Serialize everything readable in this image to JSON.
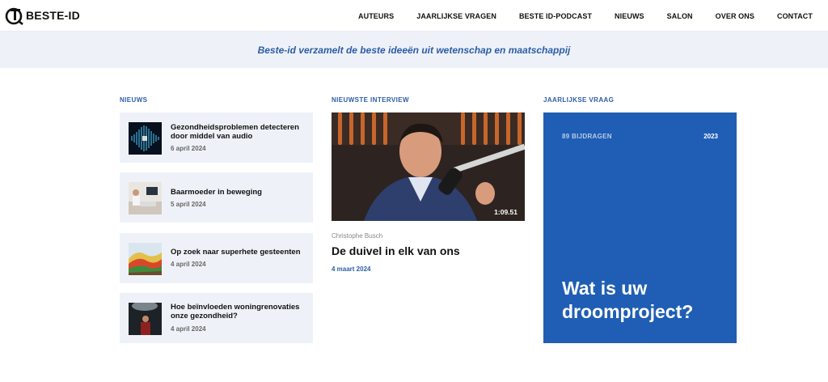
{
  "header": {
    "logo_text": "BESTE-ID",
    "nav": [
      "AUTEURS",
      "JAARLIJKSE VRAGEN",
      "BESTE ID-PODCAST",
      "NIEUWS",
      "SALON",
      "OVER ONS",
      "CONTACT"
    ]
  },
  "banner": {
    "text": "Beste-id verzamelt de beste ideeën uit wetenschap en maatschappij"
  },
  "news": {
    "label": "NIEUWS",
    "items": [
      {
        "title": "Gezondheidsproblemen detecteren door middel van audio",
        "date": "6 april 2024"
      },
      {
        "title": "Baarmoeder in beweging",
        "date": "5 april 2024"
      },
      {
        "title": "Op zoek naar superhete gesteenten",
        "date": "4 april 2024"
      },
      {
        "title": "Hoe beïnvloeden woningrenovaties onze gezondheid?",
        "date": "4 april 2024"
      }
    ]
  },
  "interview": {
    "label": "NIEUWSTE INTERVIEW",
    "duration": "1:09.51",
    "author": "Christophe Busch",
    "title": "De duivel in elk van ons",
    "date": "4 maart 2024"
  },
  "question": {
    "label": "JAARLIJKSE VRAAG",
    "contributions": "89 BIJDRAGEN",
    "year": "2023",
    "title": "Wat is uw droomproject?"
  },
  "colors": {
    "accent": "#2c5da8",
    "card_bg": "#eef2f8",
    "question_bg": "#1f5eb4"
  }
}
